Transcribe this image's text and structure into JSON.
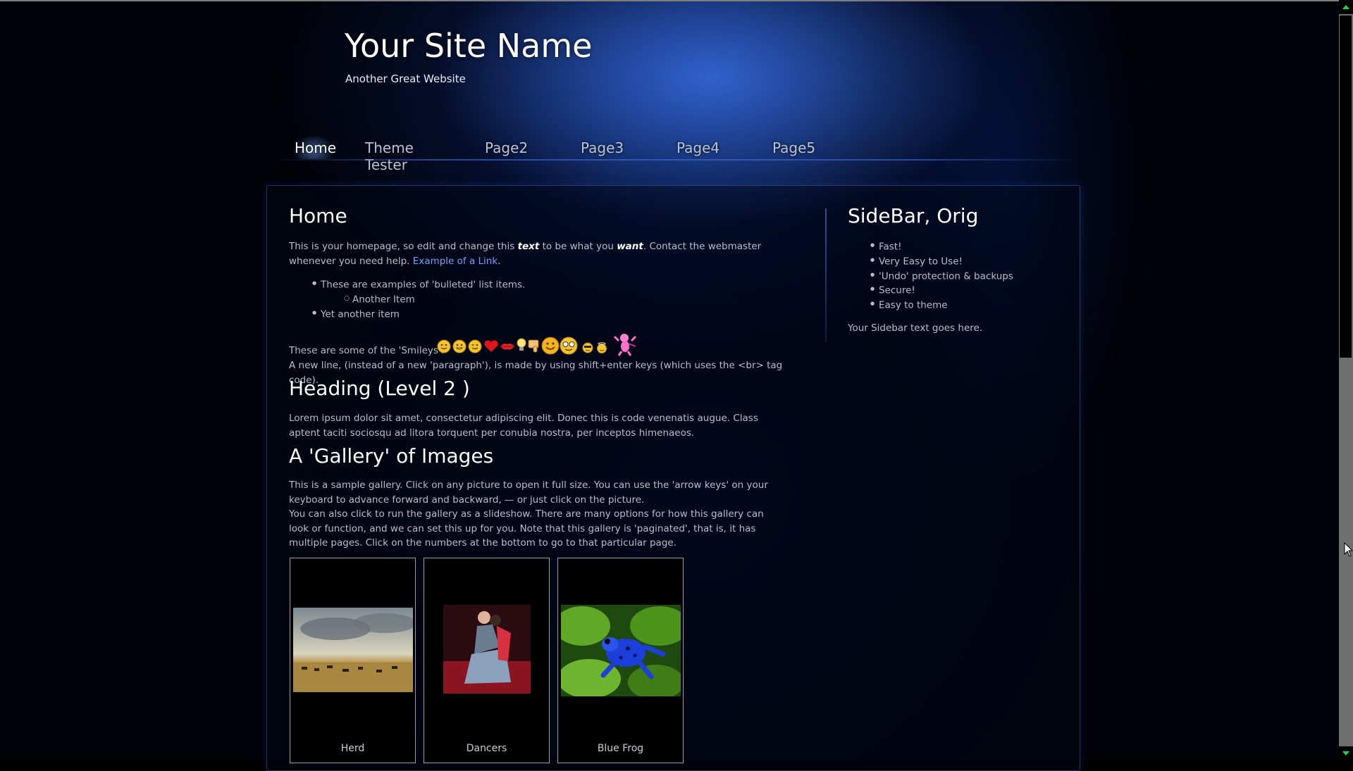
{
  "site": {
    "title": "Your Site Name",
    "tagline": "Another Great Website"
  },
  "nav": {
    "items": [
      "Home",
      "Theme Tester",
      "Page2",
      "Page3",
      "Page4",
      "Page5"
    ],
    "active": "Home"
  },
  "main": {
    "heading": "Home",
    "intro_before_text": "This is your homepage, so edit and change this ",
    "intro_text_em": "text",
    "intro_mid": " to be what you ",
    "intro_want_em": "want",
    "intro_after": ".  Contact the webmaster whenever you need help.  ",
    "link_label": "Example of a Link",
    "link_after": ".",
    "bullets": [
      {
        "text": "These are examples of 'bulleted' list items.",
        "level": 1
      },
      {
        "text": "Another Item",
        "level": 2
      },
      {
        "text": "Yet another item",
        "level": 1
      }
    ],
    "smileys_label": "These are some of the 'Smileys':",
    "newline_text": "A new line, (instead of a new 'paragraph'), is made by using shift+enter keys (which uses the <br> tag code).",
    "heading2": "Heading (Level 2 )",
    "lorem": "Lorem ipsum dolor sit amet, consectetur adipiscing elit. Donec this is code venenatis augue. Class aptent taciti sociosqu ad litora torquent per conubia nostra, per inceptos himenaeos.",
    "gallery_heading": "A 'Gallery' of Images",
    "gallery_p1": "This is a sample gallery.  Click on any picture to open it full size.  You can use the 'arrow keys' on your keyboard to advance forward and backward, — or just click on the picture.",
    "gallery_p2": "You can also click to run the gallery as a slideshow.   There are many options for how this gallery can look or function, and we can set this up for you. Note that this gallery is 'paginated', that is, it has multiple pages.   Click on the numbers at the bottom to go to that particular page.",
    "gallery": [
      {
        "caption": "Herd"
      },
      {
        "caption": "Dancers"
      },
      {
        "caption": "Blue Frog"
      }
    ]
  },
  "sidebar": {
    "heading": "SideBar, Orig",
    "items": [
      "Fast!",
      "Very Easy to Use!",
      "'Undo' protection & backups",
      "Secure!",
      "Easy to theme"
    ],
    "text": "Your Sidebar text goes here."
  },
  "colors": {
    "link": "#6fa1ff",
    "accent_blue": "#3d6fe0",
    "scroll_arrow": "#1fd43a"
  },
  "icons": [
    "smile-icon",
    "grin-icon",
    "wink-icon",
    "heart-icon",
    "lips-icon",
    "lightbulb-icon",
    "thumbs-down-icon",
    "big-smile-icon",
    "glasses-icon",
    "cool-icon",
    "angel-icon",
    "cupid-icon"
  ]
}
